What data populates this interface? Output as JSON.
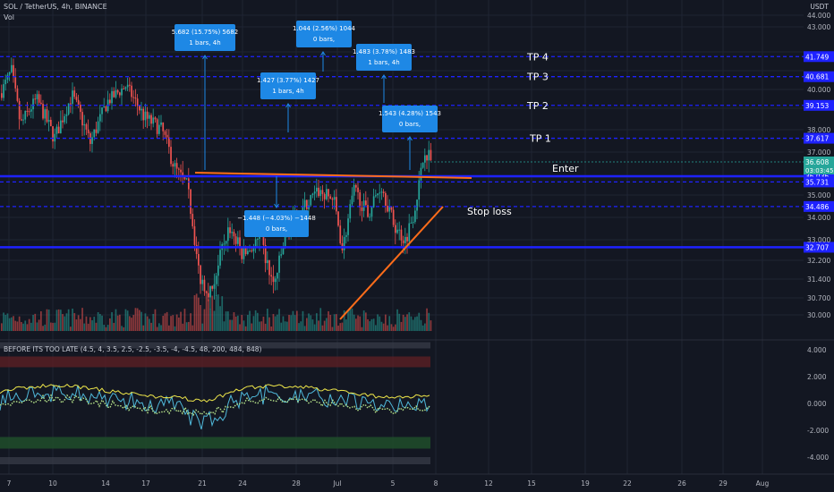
{
  "header": {
    "symbol_line": "SOL / TetherUS, 4h, BINANCE",
    "vol_label": "Vol",
    "currency": "USDT"
  },
  "indicator": {
    "title": "BEFORE ITS TOO LATE (4.5, 4, 3.5, 2.5, -2.5, -3.5, -4, -4.5, 48, 200, 484, 848)"
  },
  "colors": {
    "bg": "#131722",
    "blue_line": "#1e22ff",
    "orange": "#ff6d1a",
    "up": "#26a69a",
    "down": "#ef5350",
    "box": "#1e88e5",
    "yellow": "#f0e84a",
    "cyan": "#4fb8d9"
  },
  "chart_data": {
    "type": "candlestick",
    "price_axis": {
      "ticks": [
        "44.000",
        "43.000",
        "42.000",
        "41.000",
        "40.000",
        "39.000",
        "38.000",
        "37.000",
        "36.000",
        "35.000",
        "34.000",
        "33.000",
        "32.200",
        "31.400",
        "30.700",
        "30.000"
      ],
      "range": [
        29.8,
        44.2
      ]
    },
    "price_levels": [
      {
        "value": 41.749,
        "label": "41.749",
        "name": "TP 4"
      },
      {
        "value": 40.681,
        "label": "40.681",
        "name": "TP 3"
      },
      {
        "value": 39.153,
        "label": "39.153",
        "name": "TP 2"
      },
      {
        "value": 37.617,
        "label": "37.617",
        "name": "TP 1"
      },
      {
        "value": 36.036,
        "label": "36.036",
        "name": "Enter"
      },
      {
        "value": 35.731,
        "label": "35.731",
        "name": ""
      },
      {
        "value": 34.486,
        "label": "34.486",
        "name": "Stop loss"
      },
      {
        "value": 32.707,
        "label": "32.707",
        "name": ""
      }
    ],
    "current_price": {
      "value": 36.608,
      "label": "36.608",
      "countdown": "03:03:45"
    },
    "time_axis": [
      "7",
      "10",
      "14",
      "17",
      "21",
      "24",
      "28",
      "Jul",
      "5",
      "8",
      "12",
      "15",
      "19",
      "22",
      "26",
      "29",
      "Aug"
    ],
    "annotations": [
      {
        "line1": "5.682 (15.75%) 5682",
        "line2": "1 bars, 4h"
      },
      {
        "line1": "1.044 (2.56%) 1044",
        "line2": "0 bars,"
      },
      {
        "line1": "1.483 (3.78%) 1483",
        "line2": "1 bars, 4h"
      },
      {
        "line1": "1.427 (3.77%) 1427",
        "line2": "1 bars, 4h"
      },
      {
        "line1": "1.543 (4.28%) 1543",
        "line2": "0 bars,"
      },
      {
        "line1": "−1.448 (−4.03%) −1448",
        "line2": "0 bars,"
      }
    ],
    "indicator_axis": {
      "ticks": [
        "4.000",
        "2.000",
        "0.000",
        "-2.000",
        "-4.000"
      ],
      "range": [
        -5,
        5
      ]
    }
  }
}
